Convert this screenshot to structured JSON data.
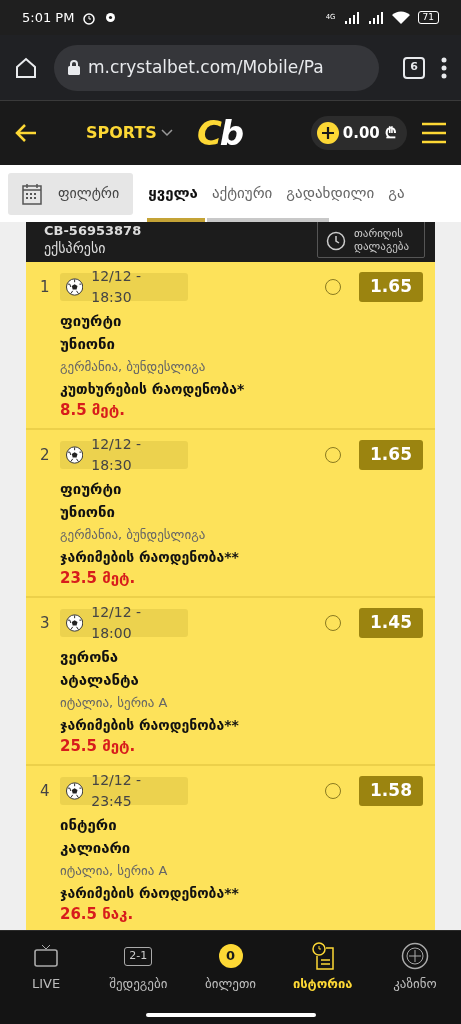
{
  "status_bar": {
    "time": "5:01 PM",
    "network": "4G",
    "battery": "71"
  },
  "browser": {
    "url": "m.crystalbet.com/Mobile/Pa",
    "tab_count": "6"
  },
  "header": {
    "section": "SPORTS",
    "logo": "Cb",
    "balance": "0.00 ₾"
  },
  "filter": {
    "label": "ფილტრი"
  },
  "tabs": [
    {
      "label": "ყველა",
      "selected": true
    },
    {
      "label": "აქტიური",
      "selected": false
    },
    {
      "label": "გადახდილი",
      "selected": false
    },
    {
      "label": "გა",
      "selected": false
    }
  ],
  "ticket": {
    "id": "CB-56953878",
    "type": "ექსპრესი",
    "sort_button": "თარიღის დალაგება"
  },
  "bets": [
    {
      "number": "1",
      "datetime": "12/12 - 18:30",
      "selected": false,
      "odds": "1.65",
      "team1": "ფიურტი",
      "team2": "უნიონი",
      "league": "გერმანია, ბუნდესლიგა",
      "market": "კუთხურების რაოდენობა*",
      "pick": "8.5 მეტ."
    },
    {
      "number": "2",
      "datetime": "12/12 - 18:30",
      "selected": false,
      "odds": "1.65",
      "team1": "ფიურტი",
      "team2": "უნიონი",
      "league": "გერმანია, ბუნდესლიგა",
      "market": "ჯარიმების რაოდენობა**",
      "pick": "23.5 მეტ."
    },
    {
      "number": "3",
      "datetime": "12/12 - 18:00",
      "selected": false,
      "odds": "1.45",
      "team1": "ვერონა",
      "team2": "ატალანტა",
      "league": "იტალია, სერია A",
      "market": "ჯარიმების რაოდენობა**",
      "pick": "25.5 მეტ."
    },
    {
      "number": "4",
      "datetime": "12/12 - 23:45",
      "selected": false,
      "odds": "1.58",
      "team1": "ინტერი",
      "team2": "კალიარი",
      "league": "იტალია, სერია A",
      "market": "ჯარიმების რაოდენობა**",
      "pick": "26.5 ნაკ."
    }
  ],
  "bottom_nav": [
    {
      "kind": "tv",
      "label": "LIVE",
      "selected": false
    },
    {
      "kind": "score",
      "icon_text": "2-1",
      "label": "შედეგები",
      "selected": false
    },
    {
      "kind": "count",
      "icon_text": "0",
      "label": "ბილეთი",
      "selected": false
    },
    {
      "kind": "history",
      "label": "ისტორია",
      "selected": true
    },
    {
      "kind": "casino",
      "label": "კაზინო",
      "selected": false
    }
  ]
}
